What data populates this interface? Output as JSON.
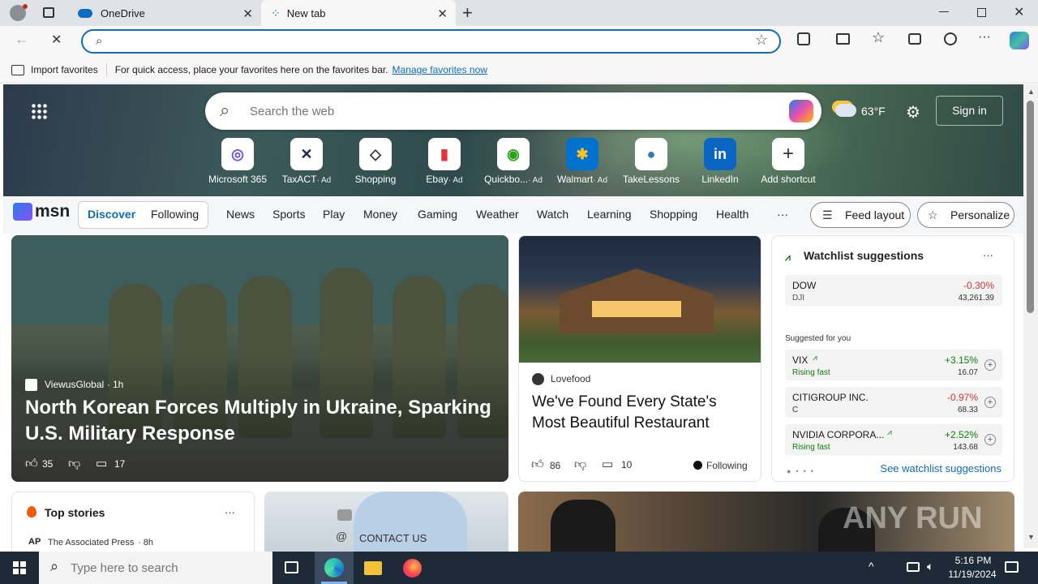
{
  "browser": {
    "tabs": [
      {
        "label": "OneDrive"
      },
      {
        "label": "New tab"
      }
    ],
    "address": {
      "value": "",
      "placeholder": ""
    },
    "favorites_bar": {
      "import_label": "Import favorites",
      "hint": "For quick access, place your favorites here on the favorites bar.",
      "manage_link": "Manage favorites now"
    }
  },
  "newtab": {
    "search_placeholder": "Search the web",
    "weather": "63°F",
    "signin_label": "Sign in",
    "shortcuts": [
      {
        "name": "Microsoft 365",
        "ad": "",
        "icon": "microsoft365-icon"
      },
      {
        "name": "TaxACT",
        "ad": "· Ad",
        "icon": "taxact-icon"
      },
      {
        "name": "Shopping",
        "ad": "",
        "icon": "shopping-tag-icon"
      },
      {
        "name": "Ebay",
        "ad": "· Ad",
        "icon": "ebay-icon"
      },
      {
        "name": "Quickbo...",
        "ad": "· Ad",
        "icon": "quickbooks-icon"
      },
      {
        "name": "Walmart",
        "ad": "· Ad",
        "icon": "walmart-icon"
      },
      {
        "name": "TakeLessons",
        "ad": "",
        "icon": "takelessons-icon"
      },
      {
        "name": "LinkedIn",
        "ad": "",
        "icon": "linkedin-icon"
      },
      {
        "name": "Add shortcut",
        "ad": "",
        "icon": "plus-icon"
      }
    ],
    "nav": {
      "logo": "msn",
      "discover": "Discover",
      "following": "Following",
      "items": [
        "News",
        "Sports",
        "Play",
        "Money",
        "Gaming",
        "Weather",
        "Watch",
        "Learning",
        "Shopping",
        "Health"
      ],
      "more": "···",
      "feed_layout": "Feed layout",
      "personalize": "Personalize"
    },
    "main_story": {
      "source": "ViewusGlobal",
      "time": "1h",
      "title": "North Korean Forces Multiply in Ukraine, Sparking U.S. Military Response",
      "likes": "35",
      "comments": "17"
    },
    "story2": {
      "source": "Lovefood",
      "title": "We've Found Every State's Most Beautiful Restaurant",
      "likes": "86",
      "comments": "10",
      "following": "Following"
    },
    "watchlist": {
      "title": "Watchlist suggestions",
      "more": "···",
      "top": {
        "name": "DOW",
        "ticker": "DJI",
        "change": "-0.30%",
        "price": "43,261.39"
      },
      "suggested_label": "Suggested for you",
      "items": [
        {
          "name": "VIX",
          "ticker": "Rising fast",
          "change": "+3.15%",
          "price": "16.07",
          "up": true
        },
        {
          "name": "CITIGROUP INC.",
          "ticker": "C",
          "change": "-0.97%",
          "price": "68.33",
          "up": false
        },
        {
          "name": "NVIDIA CORPORA...",
          "ticker": "Rising fast",
          "change": "+2.52%",
          "price": "143.68",
          "up": true
        }
      ],
      "see_more": "See watchlist suggestions"
    },
    "top_stories": {
      "title": "Top stories",
      "more": "···",
      "source": "The Associated Press",
      "time": "· 8h"
    },
    "contact_card": {
      "label": "CONTACT US"
    }
  },
  "watermark": "ANY RUN",
  "taskbar": {
    "search_placeholder": "Type here to search",
    "time": "5:16 PM",
    "date": "11/19/2024"
  },
  "colors": {
    "accent": "#0f6cbd",
    "up": "#107c10",
    "down": "#d13438",
    "taskbar": "#1f2a38"
  }
}
